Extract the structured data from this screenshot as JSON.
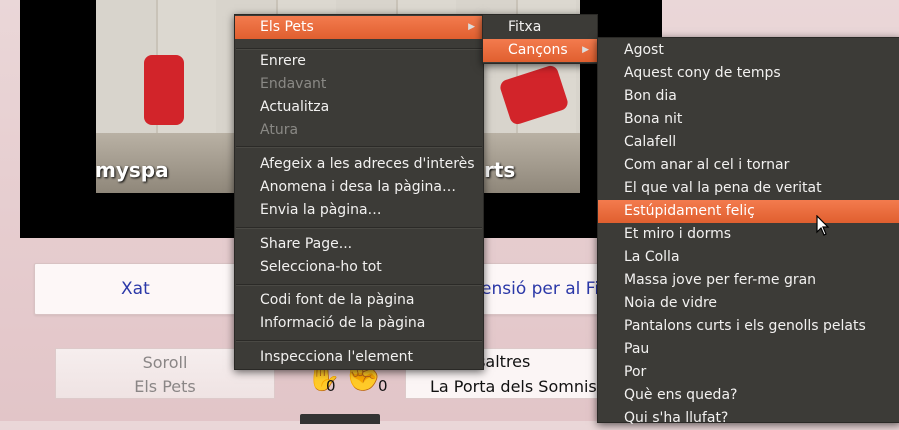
{
  "video": {
    "caption_left": "myspa",
    "caption_right": "rts"
  },
  "tabs": {
    "xat": "Xat",
    "ensio": "ensió per al Fir"
  },
  "left_card": {
    "line1": "Soroll",
    "line2": "Els Pets"
  },
  "counts": {
    "a": "0",
    "b": "0"
  },
  "right_card": {
    "line1": "re nosaltres",
    "line2": "La Porta dels Somnis"
  },
  "context_menu": {
    "items": [
      {
        "label": "Els Pets",
        "state": "active",
        "has_submenu": true
      },
      {
        "label": "Enrere",
        "state": "normal"
      },
      {
        "label": "Endavant",
        "state": "disabled"
      },
      {
        "label": "Actualitza",
        "state": "normal"
      },
      {
        "label": "Atura",
        "state": "disabled"
      },
      {
        "label": "Afegeix a les adreces d'interès",
        "state": "normal"
      },
      {
        "label": "Anomena i desa la pàgina…",
        "state": "normal"
      },
      {
        "label": "Envia la pàgina…",
        "state": "normal"
      },
      {
        "label": "Share Page...",
        "state": "normal"
      },
      {
        "label": "Selecciona-ho tot",
        "state": "normal"
      },
      {
        "label": "Codi font de la pàgina",
        "state": "normal"
      },
      {
        "label": "Informació de la pàgina",
        "state": "normal"
      },
      {
        "label": "Inspecciona l'element",
        "state": "normal"
      }
    ]
  },
  "submenu_1": {
    "items": [
      {
        "label": "Fitxa"
      },
      {
        "label": "Cançons",
        "active": true,
        "has_submenu": true
      }
    ]
  },
  "submenu_2": {
    "items": [
      "Agost",
      "Aquest cony de temps",
      "Bon dia",
      "Bona nit",
      "Calafell",
      "Com anar al cel i tornar",
      "El que val la pena de veritat",
      "Estúpidament feliç",
      "Et miro i dorms",
      "La Colla",
      "Massa jove per fer-me gran",
      "Noia de vidre",
      "Pantalons curts i els genolls pelats",
      "Pau",
      "Por",
      "Què ens queda?",
      "Qui s'ha llufat?"
    ],
    "highlighted": "Estúpidament feliç"
  },
  "colors": {
    "menu_bg": "#3c3b37",
    "highlight": "#e9693b",
    "page_bg": "#e7cfd1",
    "link": "#2b38a8"
  },
  "icons": {
    "submenu_arrow": "triangle-right",
    "cursor": "arrow-pointer"
  }
}
